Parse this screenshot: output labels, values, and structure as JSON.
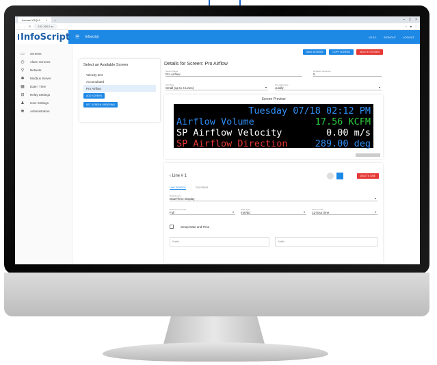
{
  "browser": {
    "tab_title": "Access XSQL0",
    "address": "192.168.0.xx",
    "window_controls": [
      "–",
      "□",
      "×"
    ]
  },
  "app": {
    "logo": "InfoScript",
    "title": "Infoscript",
    "user_menu": [
      "V2.6.1",
      "SIGNOUT",
      "LOGOUT"
    ]
  },
  "sidebar": {
    "items": [
      {
        "label": "Screens",
        "icon": "monitor-icon"
      },
      {
        "label": "Alarm Screens",
        "icon": "alarm-icon"
      },
      {
        "label": "Network",
        "icon": "network-icon"
      },
      {
        "label": "Modbus Server",
        "icon": "star-icon"
      },
      {
        "label": "Date / Time",
        "icon": "calendar-icon"
      },
      {
        "label": "Relay Settings",
        "icon": "relay-icon"
      },
      {
        "label": "User Settings",
        "icon": "users-icon"
      },
      {
        "label": "Administration",
        "icon": "admin-icon"
      }
    ]
  },
  "screen_list": {
    "heading": "Select an Available Screen",
    "options": [
      "Velocity test",
      "Accumulated",
      "Pro Airflow"
    ],
    "active_index": 2,
    "add_button": "ADD SCREEN",
    "ordering_button": "SET SCREEN ORDERING"
  },
  "details": {
    "heading": "Details for Screen: Pro Airflow",
    "buttons": {
      "save": "SAVE SCREEN",
      "copy": "COPY SCREEN",
      "delete": "DELETE SCREEN"
    },
    "screen_name_label": "Screen Name",
    "screen_name_value": "Pro Airflow",
    "duration_label": "Duration (seconds)",
    "duration_value": "5",
    "font_size_label": "Font Size",
    "font_size_value": "Small (up to 4 Lines)",
    "text_align_label": "Text Alignment",
    "text_align_value": "Justify"
  },
  "preview": {
    "title": "Screen Preview",
    "lines": [
      {
        "left": "",
        "right": "Tuesday 07/18 02:12 PM",
        "color": "#2f8ef5"
      },
      {
        "left": "Airflow Volume",
        "right": "17.56 KCFM",
        "color": "#2f8ef5",
        "right_color": "#2ecc40"
      },
      {
        "left": "SP Airflow Velocity",
        "right": "0.00 m/s",
        "color": "#ffffff"
      },
      {
        "left": "SP Airflow Direction",
        "right": "289.00 deg",
        "color": "#e53935",
        "right_color": "#2f8ef5"
      }
    ]
  },
  "line_editor": {
    "title": "Line # 1",
    "delete_button": "DELETE LINE",
    "tabs": [
      "LINE SOURCE",
      "COLORING"
    ],
    "data_source_label": "Data Source",
    "data_source_value": "Date/Time Display",
    "date_format_label": "Date/Time Format",
    "date_format_value": "Full",
    "date_style_label": "Date Style",
    "date_style_value": "mm/dd",
    "time_format_label": "Time Format",
    "time_format_value": "12-hour time",
    "setup_label": "Setup Date and Time",
    "prefix_placeholder": "Prefix",
    "suffix_placeholder": "Suffix"
  },
  "colors": {
    "primary": "#1e88e5",
    "danger": "#e53935",
    "led_bg": "#000000"
  }
}
